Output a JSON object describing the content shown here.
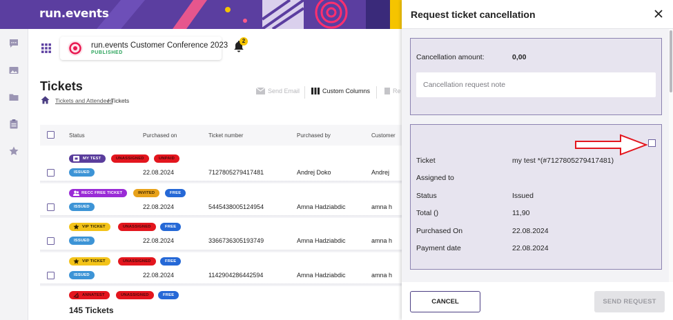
{
  "app": {
    "logo": "run.events"
  },
  "colors": {
    "brand_purple": "#5b3ea0",
    "accent_red": "#e3161e",
    "status_green": "#2aa35a",
    "badge_yellow": "#f5c400"
  },
  "sidebar": {
    "icons": [
      "chat-icon",
      "image-icon",
      "folder-icon",
      "clipboard-icon",
      "star-icon"
    ]
  },
  "event": {
    "title": "run.events Customer Conference 2023",
    "status": "PUBLISHED",
    "notifications": "2"
  },
  "page": {
    "title": "Tickets",
    "breadcrumb_link": "Tickets and Attendees",
    "breadcrumb_current": "/ Tickets"
  },
  "toolbar": {
    "send_email": "Send Email",
    "custom_columns": "Custom Columns",
    "truncated": "Re"
  },
  "table": {
    "columns": [
      "Status",
      "Purchased on",
      "Ticket number",
      "Purchased by",
      "Customer"
    ],
    "rows": [
      {
        "badges": [
          "MY TEST",
          "UNASSIGNED",
          "UNPAID"
        ],
        "status": "ISSUED",
        "purchased_on": "22.08.2024",
        "ticket_number": "7127805279417481",
        "purchased_by": "Andrej Doko",
        "customer": "Andrej"
      },
      {
        "badges": [
          "RECC FREE TICKET",
          "INVITED",
          "FREE"
        ],
        "status": "ISSUED",
        "purchased_on": "22.08.2024",
        "ticket_number": "5445438005124954",
        "purchased_by": "Amna Hadziabdic",
        "customer": "amna h"
      },
      {
        "badges": [
          "VIP TICKET",
          "UNASSIGNED",
          "FREE"
        ],
        "status": "ISSUED",
        "purchased_on": "22.08.2024",
        "ticket_number": "3366736305193749",
        "purchased_by": "Amna Hadziabdic",
        "customer": "amna h"
      },
      {
        "badges": [
          "VIP TICKET",
          "UNASSIGNED",
          "FREE"
        ],
        "status": "ISSUED",
        "purchased_on": "22.08.2024",
        "ticket_number": "1142904286442594",
        "purchased_by": "Amna Hadziabdic",
        "customer": "amna h"
      },
      {
        "badges": [
          "ANNATEST",
          "UNASSIGNED",
          "FREE"
        ]
      }
    ],
    "total": "145 Tickets"
  },
  "panel": {
    "title": "Request ticket cancellation",
    "cancellation_amount_label": "Cancellation amount:",
    "cancellation_amount_value": "0,00",
    "note_placeholder": "Cancellation request note",
    "details": [
      {
        "label": "Ticket",
        "value": "my test *(#7127805279417481)"
      },
      {
        "label": "Assigned to",
        "value": ""
      },
      {
        "label": "Status",
        "value": "Issued"
      },
      {
        "label": "Total ()",
        "value": "11,90"
      },
      {
        "label": "Purchased On",
        "value": "22.08.2024"
      },
      {
        "label": "Payment date",
        "value": "22.08.2024"
      }
    ],
    "cancel_label": "CANCEL",
    "send_label": "SEND REQUEST"
  }
}
